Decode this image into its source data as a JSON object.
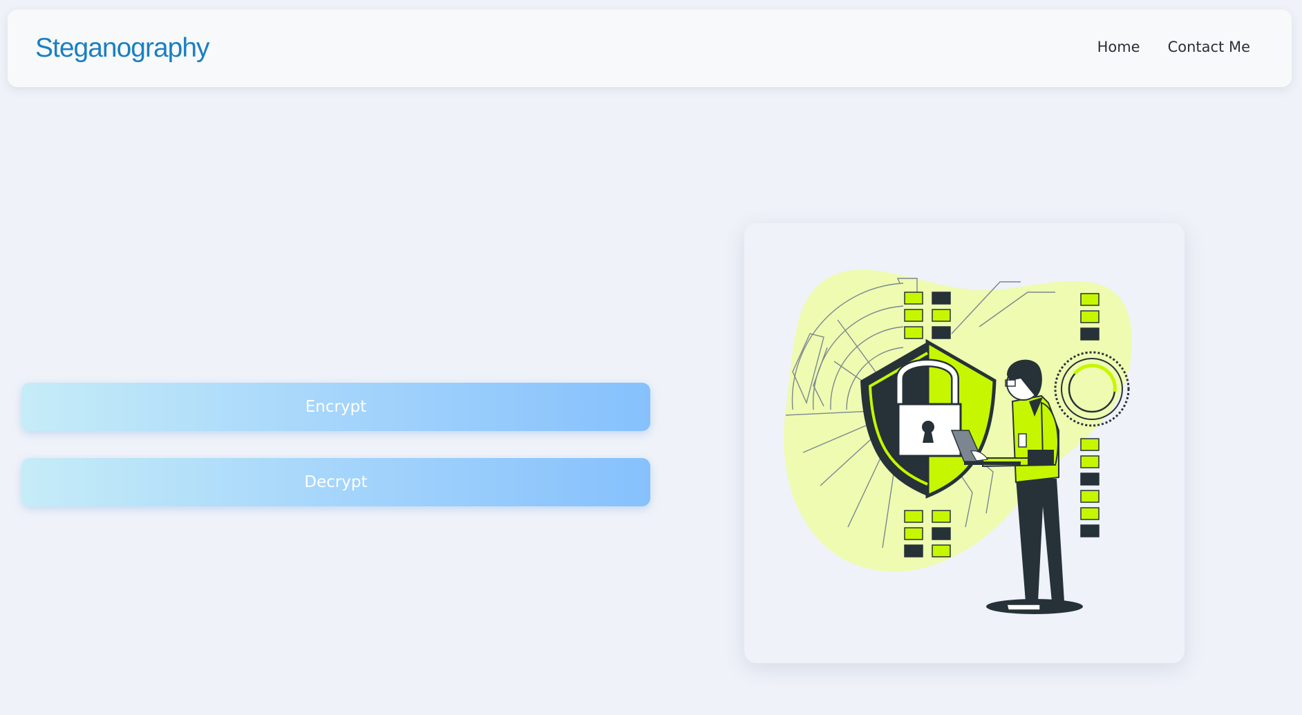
{
  "brand": {
    "name": "Steganography"
  },
  "nav": {
    "items": [
      {
        "label": "Home"
      },
      {
        "label": "Contact Me"
      }
    ]
  },
  "actions": {
    "encrypt_label": "Encrypt",
    "decrypt_label": "Decrypt"
  },
  "illustration": {
    "subject": "security-illustration",
    "colors": {
      "accent": "#c6f600",
      "accent_light": "#eefbb1",
      "dark": "#263238",
      "white": "#ffffff"
    }
  },
  "theme": {
    "background": "#eff2f8",
    "brand_color": "#1a7fc1",
    "button_gradient": [
      "#c5ecf7",
      "#86c1fd"
    ]
  }
}
